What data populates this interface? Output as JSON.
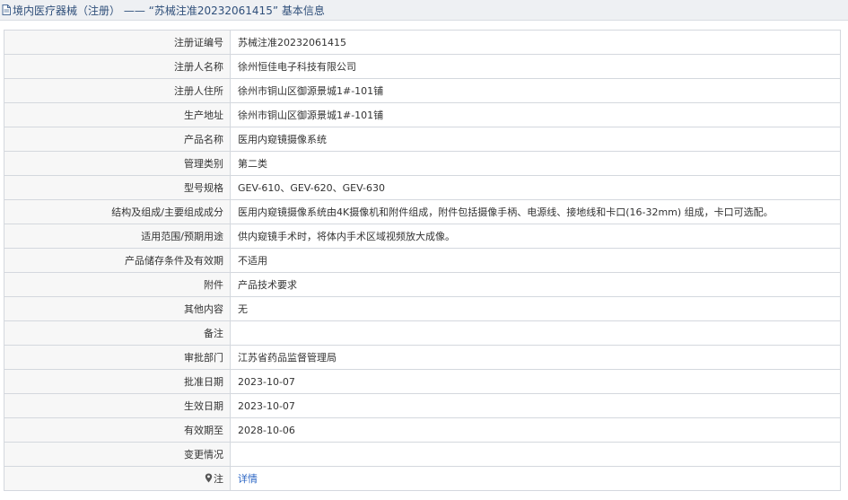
{
  "header": {
    "title": "境内医疗器械（注册） —— “苏械注准20232061415” 基本信息",
    "icon": "document-icon"
  },
  "rows": [
    {
      "label": "注册证编号",
      "value": "苏械注准20232061415"
    },
    {
      "label": "注册人名称",
      "value": "徐州恒佳电子科技有限公司"
    },
    {
      "label": "注册人住所",
      "value": "徐州市铜山区御源景城1#-101铺"
    },
    {
      "label": "生产地址",
      "value": "徐州市铜山区御源景城1#-101铺"
    },
    {
      "label": "产品名称",
      "value": "医用内窥镜摄像系统"
    },
    {
      "label": "管理类别",
      "value": "第二类"
    },
    {
      "label": "型号规格",
      "value": "GEV-610、GEV-620、GEV-630"
    },
    {
      "label": "结构及组成/主要组成成分",
      "value": "医用内窥镜摄像系统由4K摄像机和附件组成，附件包括摄像手柄、电源线、接地线和卡口(16-32mm) 组成，卡口可选配。"
    },
    {
      "label": "适用范围/预期用途",
      "value": "供内窥镜手术时，将体内手术区域视频放大成像。"
    },
    {
      "label": "产品储存条件及有效期",
      "value": "不适用"
    },
    {
      "label": "附件",
      "value": "产品技术要求"
    },
    {
      "label": "其他内容",
      "value": "无"
    },
    {
      "label": "备注",
      "value": ""
    },
    {
      "label": "审批部门",
      "value": "江苏省药品监督管理局"
    },
    {
      "label": "批准日期",
      "value": "2023-10-07"
    },
    {
      "label": "生效日期",
      "value": "2023-10-07"
    },
    {
      "label": "有效期至",
      "value": "2028-10-06"
    },
    {
      "label": "变更情况",
      "value": ""
    }
  ],
  "note_row": {
    "icon": "pin-icon",
    "label": "注",
    "link_text": "详情",
    "link_color": "#2b66c4"
  }
}
